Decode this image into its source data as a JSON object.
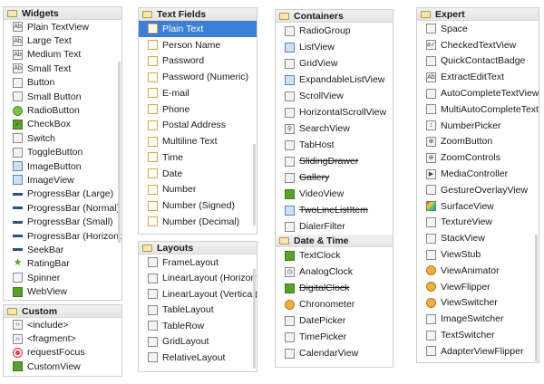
{
  "panels": [
    {
      "id": "widgets",
      "title": "Widgets",
      "items": [
        {
          "label": "Plain TextView",
          "icon": "ab"
        },
        {
          "label": "Large Text",
          "icon": "ab"
        },
        {
          "label": "Medium Text",
          "icon": "ab"
        },
        {
          "label": "Small Text",
          "icon": "ab"
        },
        {
          "label": "Button",
          "icon": "button"
        },
        {
          "label": "Small Button",
          "icon": "button"
        },
        {
          "label": "RadioButton",
          "icon": "radio"
        },
        {
          "label": "CheckBox",
          "icon": "check"
        },
        {
          "label": "Switch",
          "icon": "switch"
        },
        {
          "label": "ToggleButton",
          "icon": "toggle"
        },
        {
          "label": "ImageButton",
          "icon": "image"
        },
        {
          "label": "ImageView",
          "icon": "image"
        },
        {
          "label": "ProgressBar (Large)",
          "icon": "progress"
        },
        {
          "label": "ProgressBar (Normal)",
          "icon": "progress"
        },
        {
          "label": "ProgressBar (Small)",
          "icon": "progress"
        },
        {
          "label": "ProgressBar (Horizontal)",
          "icon": "progress"
        },
        {
          "label": "SeekBar",
          "icon": "seekbar"
        },
        {
          "label": "RatingBar",
          "icon": "star"
        },
        {
          "label": "Spinner",
          "icon": "spinner"
        },
        {
          "label": "WebView",
          "icon": "globe"
        }
      ]
    },
    {
      "id": "custom",
      "title": "Custom",
      "items": [
        {
          "label": "<include>",
          "icon": "tag"
        },
        {
          "label": "<fragment>",
          "icon": "tag"
        },
        {
          "label": "requestFocus",
          "icon": "target"
        },
        {
          "label": "CustomView",
          "icon": "custom"
        }
      ]
    },
    {
      "id": "textfields",
      "title": "Text Fields",
      "items": [
        {
          "label": "Plain Text",
          "icon": "field",
          "selected": true
        },
        {
          "label": "Person Name",
          "icon": "field"
        },
        {
          "label": "Password",
          "icon": "field"
        },
        {
          "label": "Password (Numeric)",
          "icon": "field"
        },
        {
          "label": "E-mail",
          "icon": "field"
        },
        {
          "label": "Phone",
          "icon": "field"
        },
        {
          "label": "Postal Address",
          "icon": "field"
        },
        {
          "label": "Multiline Text",
          "icon": "field"
        },
        {
          "label": "Time",
          "icon": "field"
        },
        {
          "label": "Date",
          "icon": "field"
        },
        {
          "label": "Number",
          "icon": "field"
        },
        {
          "label": "Number (Signed)",
          "icon": "field"
        },
        {
          "label": "Number (Decimal)",
          "icon": "field"
        }
      ]
    },
    {
      "id": "layouts",
      "title": "Layouts",
      "items": [
        {
          "label": "FrameLayout",
          "icon": "layout"
        },
        {
          "label": "LinearLayout (Horizontal)",
          "icon": "layout"
        },
        {
          "label": "LinearLayout (Vertical)",
          "icon": "layout"
        },
        {
          "label": "TableLayout",
          "icon": "layout"
        },
        {
          "label": "TableRow",
          "icon": "layout"
        },
        {
          "label": "GridLayout",
          "icon": "layout"
        },
        {
          "label": "RelativeLayout",
          "icon": "layout"
        }
      ]
    },
    {
      "id": "containers",
      "title": "Containers",
      "items": [
        {
          "label": "RadioGroup",
          "icon": "group"
        },
        {
          "label": "ListView",
          "icon": "list"
        },
        {
          "label": "GridView",
          "icon": "grid"
        },
        {
          "label": "ExpandableListView",
          "icon": "list"
        },
        {
          "label": "ScrollView",
          "icon": "scroll"
        },
        {
          "label": "HorizontalScrollView",
          "icon": "scroll"
        },
        {
          "label": "SearchView",
          "icon": "search"
        },
        {
          "label": "TabHost",
          "icon": "tab"
        },
        {
          "label": "SlidingDrawer",
          "icon": "drawer",
          "deprecated": true
        },
        {
          "label": "Gallery",
          "icon": "gallery",
          "deprecated": true
        },
        {
          "label": "VideoView",
          "icon": "video"
        },
        {
          "label": "TwoLineListItem",
          "icon": "list",
          "deprecated": true
        },
        {
          "label": "DialerFilter",
          "icon": "phone"
        }
      ]
    },
    {
      "id": "datetime",
      "title": "Date & Time",
      "items": [
        {
          "label": "TextClock",
          "icon": "textclock"
        },
        {
          "label": "AnalogClock",
          "icon": "clock"
        },
        {
          "label": "DigitalClock",
          "icon": "digital",
          "deprecated": true
        },
        {
          "label": "Chronometer",
          "icon": "chrono"
        },
        {
          "label": "DatePicker",
          "icon": "picker"
        },
        {
          "label": "TimePicker",
          "icon": "picker"
        },
        {
          "label": "CalendarView",
          "icon": "calendar"
        }
      ]
    },
    {
      "id": "expert",
      "title": "Expert",
      "items": [
        {
          "label": "Space",
          "icon": "space"
        },
        {
          "label": "CheckedTextView",
          "icon": "checked"
        },
        {
          "label": "QuickContactBadge",
          "icon": "contact"
        },
        {
          "label": "ExtractEditText",
          "icon": "ab"
        },
        {
          "label": "AutoCompleteTextView",
          "icon": "autocomplete"
        },
        {
          "label": "MultiAutoCompleteTextView",
          "icon": "autocomplete"
        },
        {
          "label": "NumberPicker",
          "icon": "number"
        },
        {
          "label": "ZoomButton",
          "icon": "zoom"
        },
        {
          "label": "ZoomControls",
          "icon": "zoom"
        },
        {
          "label": "MediaController",
          "icon": "play"
        },
        {
          "label": "GestureOverlayView",
          "icon": "gesture"
        },
        {
          "label": "SurfaceView",
          "icon": "surface"
        },
        {
          "label": "TextureView",
          "icon": "texture"
        },
        {
          "label": "StackView",
          "icon": "stack"
        },
        {
          "label": "ViewStub",
          "icon": "stub"
        },
        {
          "label": "ViewAnimator",
          "icon": "animator"
        },
        {
          "label": "ViewFlipper",
          "icon": "animator"
        },
        {
          "label": "ViewSwitcher",
          "icon": "animator"
        },
        {
          "label": "ImageSwitcher",
          "icon": "switcher"
        },
        {
          "label": "TextSwitcher",
          "icon": "switcher"
        },
        {
          "label": "AdapterViewFlipper",
          "icon": "flipper"
        }
      ]
    }
  ],
  "colors": {
    "selection": "#3b7fd6",
    "folder": "#f6e7b0"
  }
}
